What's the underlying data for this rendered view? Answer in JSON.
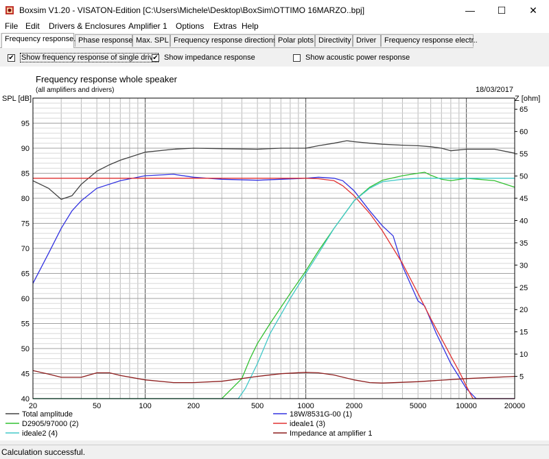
{
  "window": {
    "title": "Boxsim V1.20 - VISATON-Edition [C:\\Users\\Michele\\Desktop\\BoxSim\\OTTIMO 16MARZO..bpj]",
    "minimize": "—",
    "maximize": "☐",
    "close": "✕"
  },
  "menu": {
    "items": [
      "File",
      "Edit",
      "Drivers & Enclosures",
      "Amplifier 1",
      "Options",
      "Extras",
      "Help"
    ]
  },
  "tabs": {
    "items": [
      "Frequency response.",
      "Phase response",
      "Max. SPL",
      "Frequency response directions",
      "Polar plots",
      "Directivity",
      "Driver",
      "Frequency response electr.."
    ],
    "active": 0
  },
  "options": {
    "single_driver": {
      "label": "Show frequency response of single drive",
      "checked": true
    },
    "impedance": {
      "label": "Show impedance response",
      "checked": true
    },
    "acoustic_power": {
      "label": "Show acoustic power response",
      "checked": false
    }
  },
  "chart_data": {
    "type": "line",
    "title": "Frequency response whole speaker",
    "subtitle": "(all amplifiers and drivers)",
    "date": "18/03/2017",
    "ylabel": "SPL [dB]",
    "y2label": "Z [ohm]",
    "xscale": "log",
    "xlim": [
      20,
      20000
    ],
    "ylim": [
      40,
      100
    ],
    "y2lim": [
      0,
      67.5
    ],
    "x_ticks": [
      20,
      50,
      100,
      200,
      500,
      1000,
      2000,
      5000,
      10000,
      20000
    ],
    "y_ticks": [
      40,
      45,
      50,
      55,
      60,
      65,
      70,
      75,
      80,
      85,
      90,
      95
    ],
    "y2_ticks": [
      5,
      10,
      15,
      20,
      25,
      30,
      35,
      40,
      45,
      50,
      55,
      60,
      65
    ],
    "grid": true,
    "legend_position": "bottom",
    "series": [
      {
        "name": "Total amplitude",
        "color": "#404040",
        "axis": "left",
        "x": [
          20,
          25,
          30,
          35,
          40,
          50,
          60,
          70,
          100,
          150,
          200,
          300,
          500,
          700,
          1000,
          1200,
          1500,
          1800,
          2000,
          2500,
          3000,
          4000,
          5000,
          6000,
          7000,
          8000,
          10000,
          15000,
          20000
        ],
        "y": [
          83.5,
          82,
          79.8,
          80.5,
          82.8,
          85.4,
          86.7,
          87.6,
          89.2,
          89.8,
          90,
          89.9,
          89.8,
          90,
          90,
          90.5,
          91,
          91.5,
          91.3,
          91,
          90.8,
          90.6,
          90.5,
          90.3,
          90,
          89.5,
          89.8,
          89.8,
          89
        ]
      },
      {
        "name": "18W/8531G-00 (1)",
        "color": "#3030e0",
        "axis": "left",
        "x": [
          20,
          25,
          30,
          35,
          40,
          50,
          70,
          100,
          150,
          200,
          300,
          500,
          700,
          1000,
          1200,
          1500,
          1700,
          2000,
          2500,
          3000,
          3500,
          4000,
          5000,
          5500,
          6500,
          8000,
          10000,
          11500,
          20000
        ],
        "y": [
          63,
          69,
          74,
          77.5,
          79.5,
          82,
          83.5,
          84.5,
          84.8,
          84.2,
          83.8,
          83.6,
          83.8,
          84,
          84.2,
          84,
          83.5,
          81.5,
          77.5,
          74.5,
          72.5,
          66.5,
          59.5,
          58.5,
          53,
          47,
          42,
          40,
          40
        ]
      },
      {
        "name": "D2905/97000 (2)",
        "color": "#30c030",
        "axis": "left",
        "x": [
          20,
          300,
          400,
          450,
          500,
          600,
          800,
          1000,
          1200,
          1500,
          2000,
          2500,
          3000,
          4000,
          5000,
          5500,
          6000,
          7000,
          8000,
          10000,
          15000,
          20000
        ],
        "y": [
          40,
          40,
          44,
          48,
          51,
          55,
          61,
          65.5,
          69.5,
          74,
          79.5,
          82.2,
          83.6,
          84.5,
          85,
          85.2,
          84.6,
          83.8,
          83.5,
          84,
          83.5,
          82.2
        ]
      },
      {
        "name": "ideale1 (3)",
        "color": "#e03030",
        "axis": "left",
        "x": [
          20,
          500,
          1000,
          1200,
          1500,
          1700,
          2000,
          2500,
          3000,
          4000,
          5000,
          6000,
          7000,
          8000,
          9000,
          10000,
          11000,
          20000
        ],
        "y": [
          84,
          84,
          84,
          83.9,
          83.5,
          82.5,
          80.5,
          77,
          73.5,
          67,
          61,
          56,
          52,
          48.5,
          45.5,
          42.5,
          40,
          40
        ]
      },
      {
        "name": "ideale2 (4)",
        "color": "#40c8c8",
        "axis": "left",
        "x": [
          20,
          380,
          420,
          500,
          600,
          800,
          1000,
          1200,
          1500,
          2000,
          2500,
          3000,
          4000,
          5000,
          20000
        ],
        "y": [
          40,
          40,
          42,
          47,
          53,
          60,
          65,
          69,
          74,
          79.5,
          82,
          83.3,
          83.8,
          84,
          84
        ]
      },
      {
        "name": "Impedance at amplifier 1",
        "color": "#8b1a1a",
        "axis": "right",
        "x": [
          20,
          25,
          30,
          40,
          50,
          60,
          70,
          100,
          150,
          200,
          300,
          500,
          700,
          1000,
          1200,
          1500,
          2000,
          2500,
          3000,
          5000,
          10000,
          20000
        ],
        "y": [
          6.3,
          5.5,
          4.8,
          4.8,
          5.8,
          5.8,
          5.2,
          4.2,
          3.6,
          3.6,
          3.9,
          5.0,
          5.6,
          5.9,
          5.8,
          5.3,
          4.2,
          3.6,
          3.5,
          3.8,
          4.5,
          5.0
        ]
      }
    ]
  },
  "status": {
    "text": "Calculation successful."
  }
}
